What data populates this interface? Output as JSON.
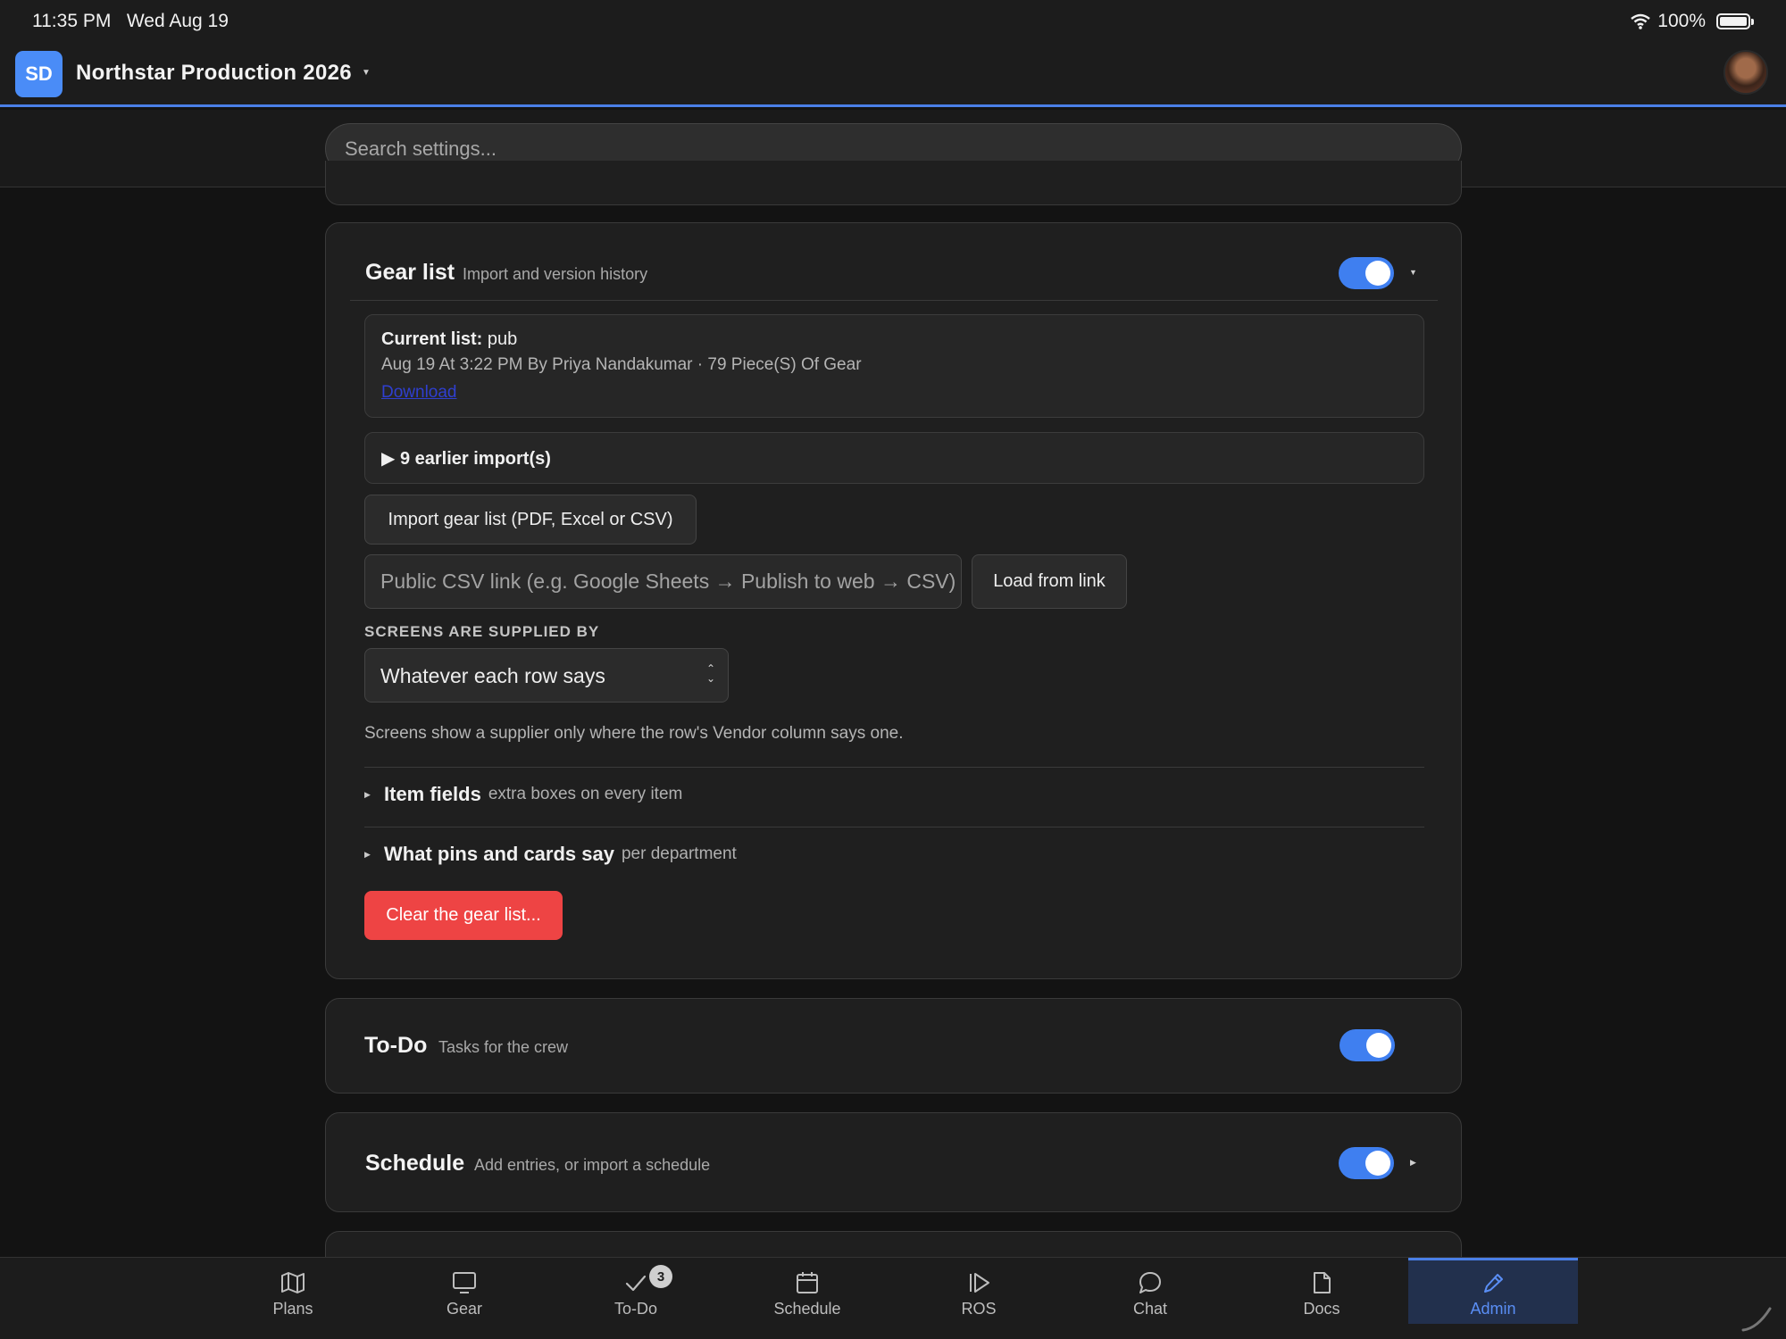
{
  "status": {
    "time": "11:35 PM",
    "date": "Wed Aug 19",
    "battery": "100%"
  },
  "header": {
    "logo_initials": "SD",
    "project_title": "Northstar Production 2026"
  },
  "search": {
    "placeholder": "Search settings..."
  },
  "gear_card": {
    "title": "Gear list",
    "subtitle": "Import and version history",
    "enabled": true,
    "current_label": "Current list:",
    "current_value": "pub",
    "current_meta": "Aug 19 At 3:22 PM By Priya Nandakumar · 79 Piece(S) Of Gear",
    "download_label": "Download",
    "earlier_imports": "▶ 9 earlier import(s)",
    "import_button": "Import gear list (PDF, Excel or CSV)",
    "csv_placeholder": "Public CSV link (e.g. Google Sheets → Publish to web → CSV)",
    "load_button": "Load from link",
    "screens_label": "SCREENS ARE SUPPLIED BY",
    "screens_value": "Whatever each row says",
    "screens_help": "Screens show a supplier only where the row's Vendor column says one.",
    "item_fields_title": "Item fields",
    "item_fields_sub": "extra boxes on every item",
    "pins_title": "What pins and cards say",
    "pins_sub": "per department",
    "clear_button": "Clear the gear list..."
  },
  "todo_card": {
    "title": "To-Do",
    "subtitle": "Tasks for the crew",
    "enabled": true
  },
  "schedule_card": {
    "title": "Schedule",
    "subtitle": "Add entries, or import a schedule",
    "enabled": true
  },
  "tabs": [
    {
      "label": "Plans",
      "icon": "map-icon"
    },
    {
      "label": "Gear",
      "icon": "monitor-icon"
    },
    {
      "label": "To-Do",
      "icon": "check-icon",
      "badge": "3"
    },
    {
      "label": "Schedule",
      "icon": "calendar-icon"
    },
    {
      "label": "ROS",
      "icon": "play-icon"
    },
    {
      "label": "Chat",
      "icon": "chat-bubble-icon"
    },
    {
      "label": "Docs",
      "icon": "document-icon"
    },
    {
      "label": "Admin",
      "icon": "pencil-icon",
      "active": true
    }
  ],
  "colors": {
    "accent": "#4a7fe6",
    "danger": "#ee4444",
    "background": "#131313",
    "card": "#1f1f1f"
  }
}
